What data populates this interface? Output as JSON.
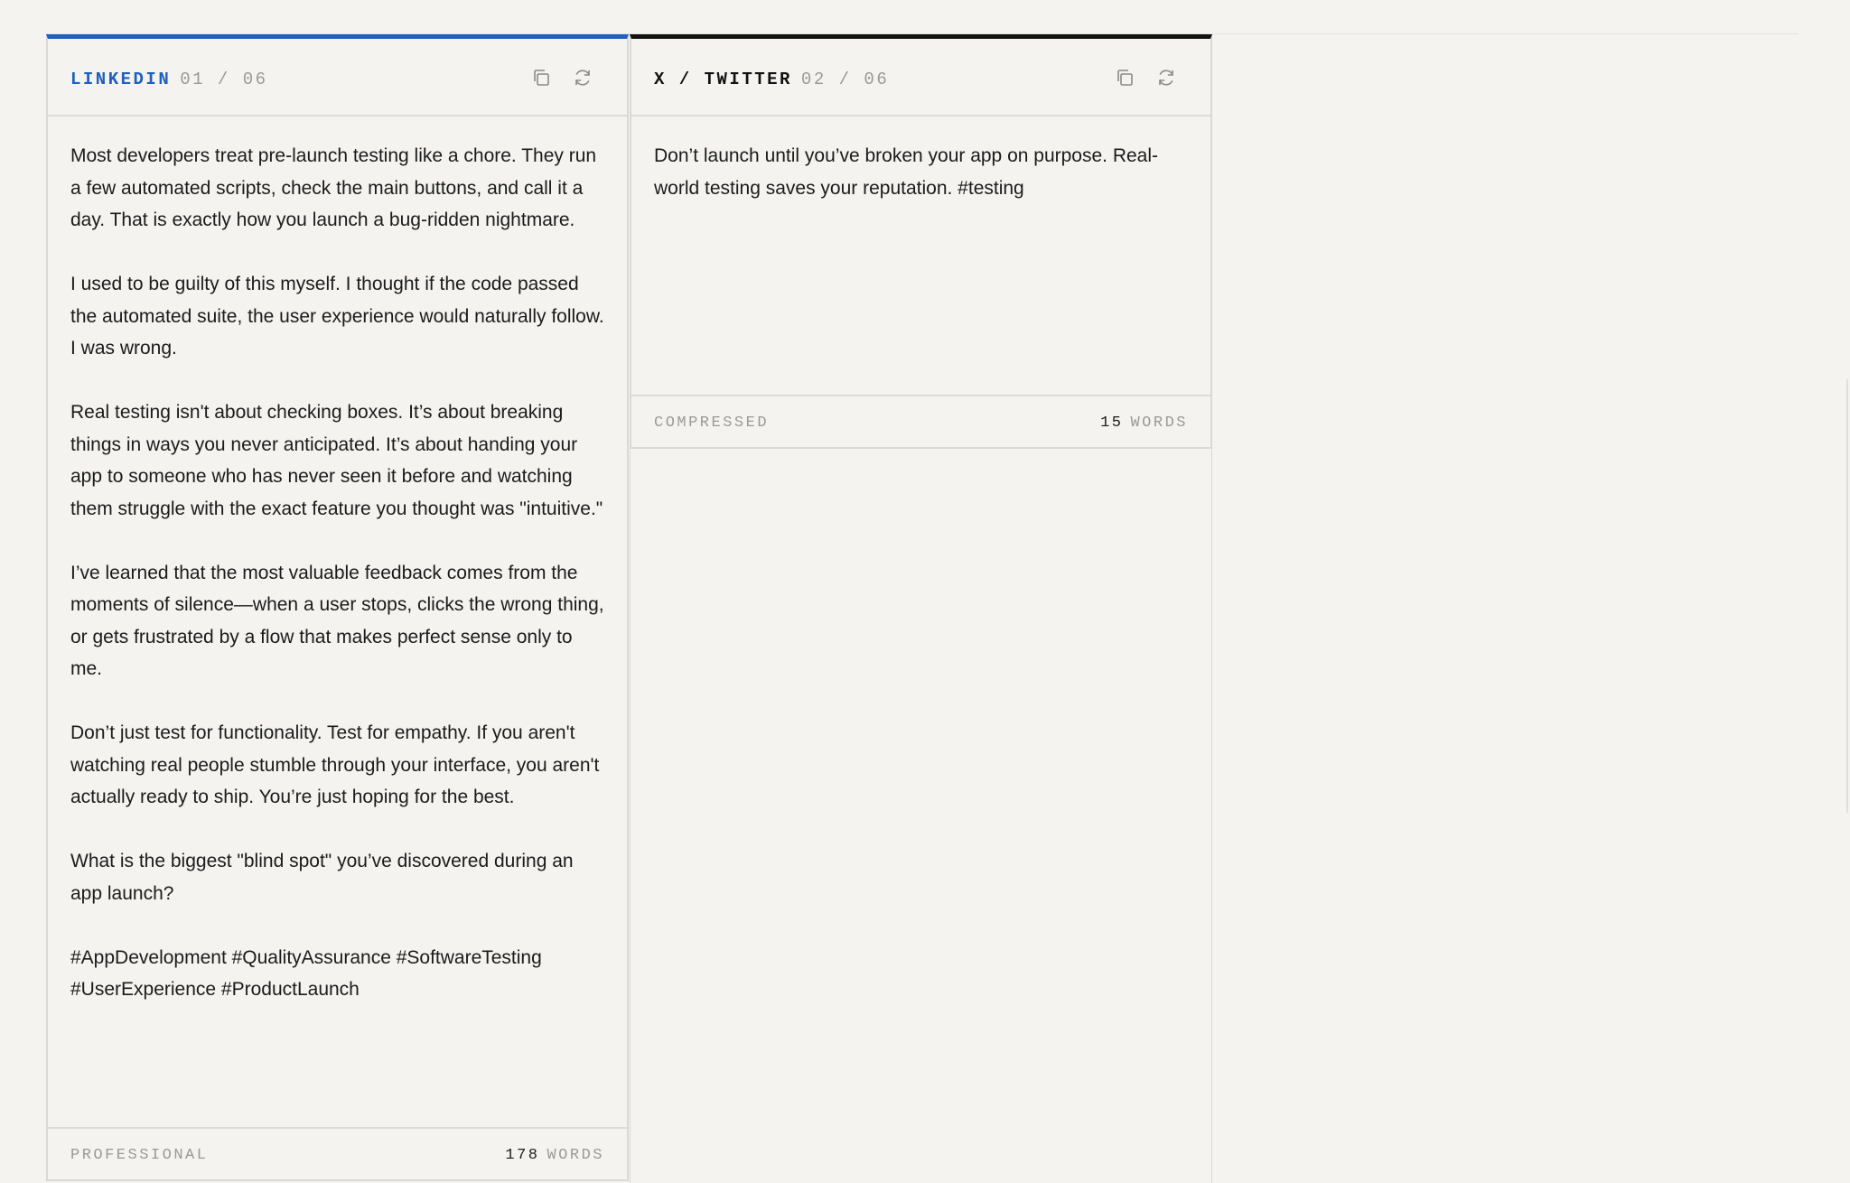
{
  "colors": {
    "linkedin_accent": "#1f5fbf",
    "twitter_accent": "#111111",
    "background": "#f4f3ef",
    "muted_text": "#9a9994"
  },
  "cards": [
    {
      "platform": "LINKEDIN",
      "counter": "01 / 06",
      "icons": [
        "copy-icon",
        "regenerate-icon"
      ],
      "paragraphs": [
        "Most developers treat pre-launch testing like a chore. They run a few automated scripts, check the main buttons, and call it a day. That is exactly how you launch a bug-ridden nightmare.",
        "I used to be guilty of this myself. I thought if the code passed the automated suite, the user experience would naturally follow. I was wrong.",
        "Real testing isn't about checking boxes. It’s about breaking things in ways you never anticipated. It’s about handing your app to someone who has never seen it before and watching them struggle with the exact feature you thought was \"intuitive.\"",
        "I’ve learned that the most valuable feedback comes from the moments of silence—when a user stops, clicks the wrong thing, or gets frustrated by a flow that makes perfect sense only to me.",
        "Don’t just test for functionality. Test for empathy. If you aren't watching real people stumble through your interface, you aren't actually ready to ship. You’re just hoping for the best.",
        "What is the biggest \"blind spot\" you’ve discovered during an app launch?",
        "#AppDevelopment #QualityAssurance #SoftwareTesting #UserExperience #ProductLaunch"
      ],
      "tone": "PROFESSIONAL",
      "word_count": "178",
      "word_unit": "WORDS"
    },
    {
      "platform": "X / TWITTER",
      "counter": "02 / 06",
      "icons": [
        "copy-icon",
        "regenerate-icon"
      ],
      "paragraphs": [
        "Don’t launch until you’ve broken your app on purpose. Real-world testing saves your reputation. #testing"
      ],
      "tone": "COMPRESSED",
      "word_count": "15",
      "word_unit": "WORDS"
    }
  ]
}
